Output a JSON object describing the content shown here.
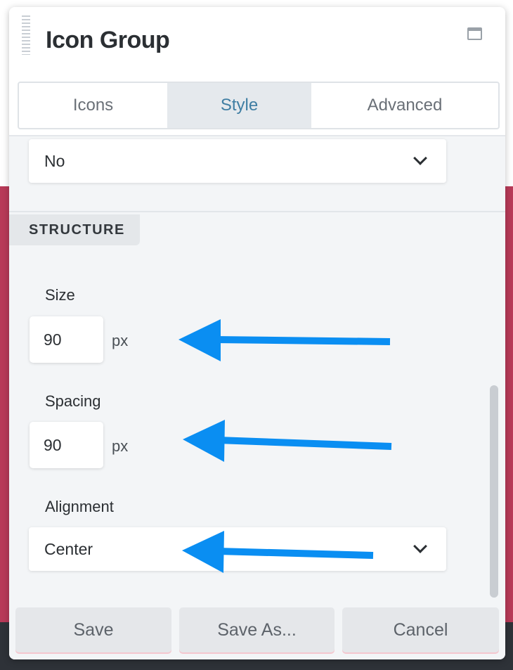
{
  "panel": {
    "title": "Icon Group",
    "tabs": [
      "Icons",
      "Style",
      "Advanced"
    ],
    "active_tab": "Style"
  },
  "top_select": {
    "value": "No"
  },
  "structure": {
    "heading": "STRUCTURE",
    "size": {
      "label": "Size",
      "value": "90",
      "unit": "px"
    },
    "spacing": {
      "label": "Spacing",
      "value": "90",
      "unit": "px"
    },
    "alignment": {
      "label": "Alignment",
      "value": "Center"
    }
  },
  "footer": {
    "save": "Save",
    "save_as": "Save As...",
    "cancel": "Cancel"
  },
  "colors": {
    "accent_tab_text": "#3f7ea3",
    "annotation_arrow": "#0a8ef2",
    "background_band": "#b83a58",
    "bottom_bar": "#2e3238"
  },
  "icons": [
    "drag-handle-icon",
    "window-icon",
    "chevron-down-icon",
    "annotation-arrow-icon"
  ]
}
